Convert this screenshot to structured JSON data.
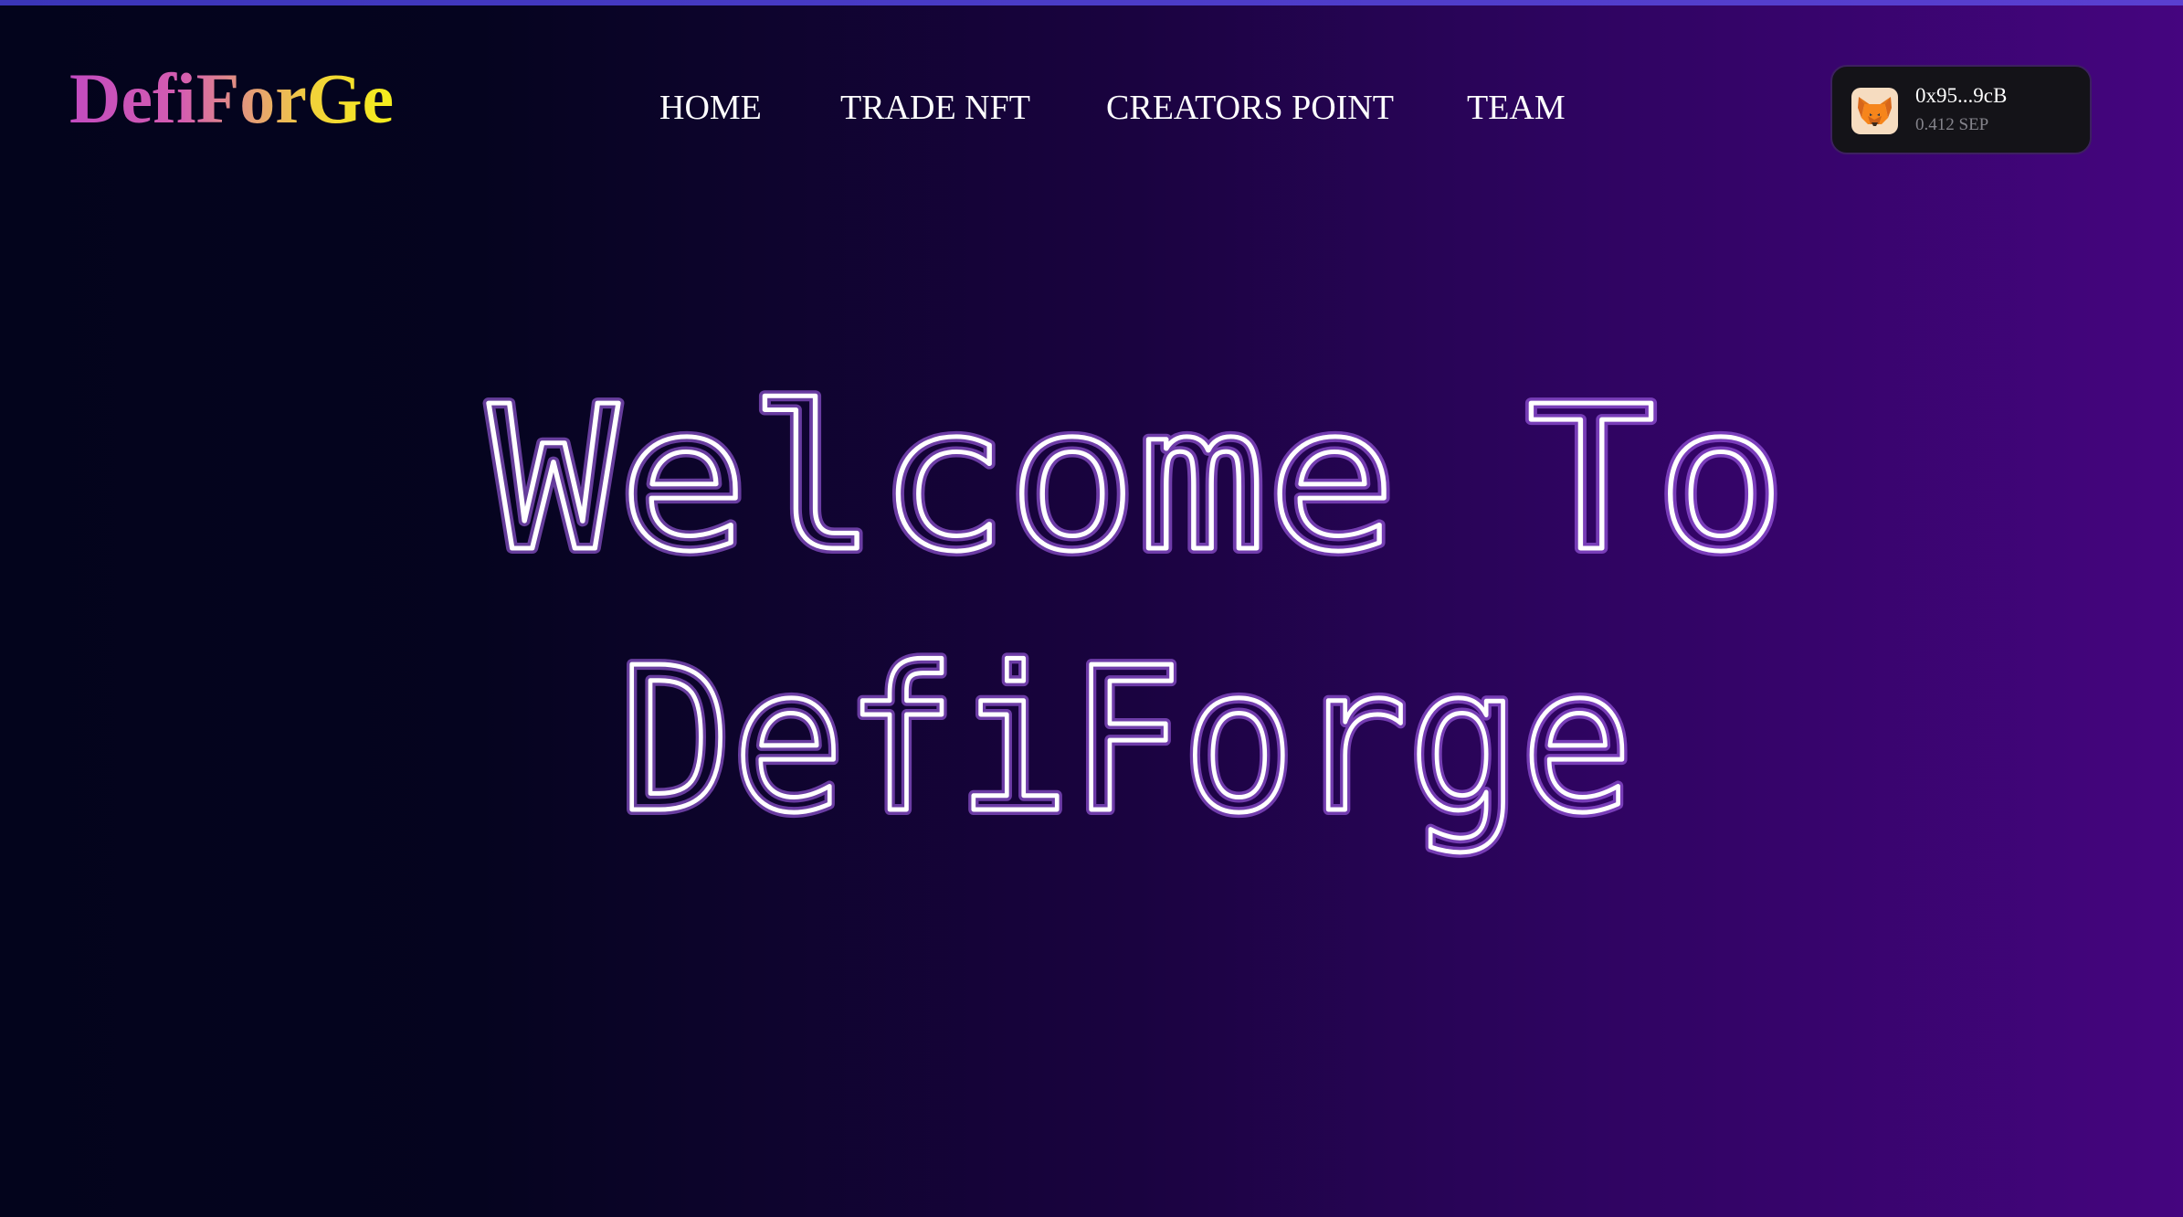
{
  "header": {
    "logo_text": "DefiForGe"
  },
  "nav": {
    "items": [
      {
        "label": "HOME"
      },
      {
        "label": "TRADE NFT"
      },
      {
        "label": "CREATORS POINT"
      },
      {
        "label": "TEAM"
      }
    ]
  },
  "wallet": {
    "icon": "metamask-fox-icon",
    "address": "0x95...9cB",
    "balance": "0.412 SEP"
  },
  "hero": {
    "line1": "Welcome To",
    "line2": "DefiForge"
  },
  "colors": {
    "background_left": "#03041c",
    "background_right": "#45057f",
    "top_accent": "#4b3cc8",
    "logo_gradient_start": "#c24bc0",
    "logo_gradient_end": "#f4ee1c",
    "hero_glow": "#b46cff",
    "wallet_bg": "#141318"
  }
}
